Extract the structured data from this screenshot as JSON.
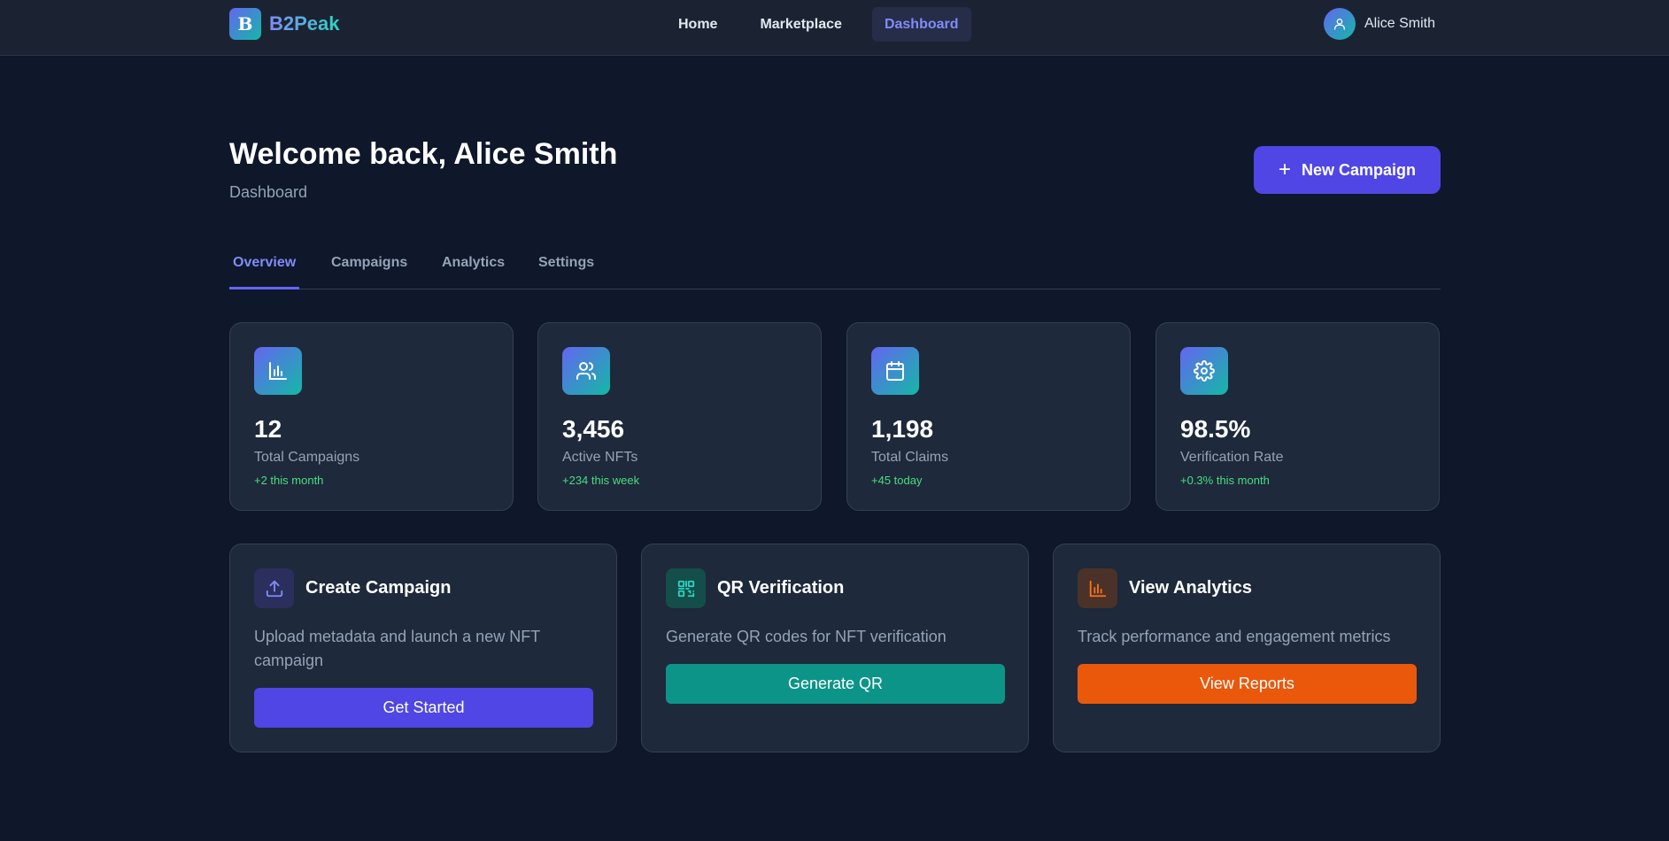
{
  "brand": {
    "logo_letter": "B",
    "name": "B2Peak"
  },
  "nav": {
    "items": [
      {
        "label": "Home"
      },
      {
        "label": "Marketplace"
      },
      {
        "label": "Dashboard",
        "active": true
      }
    ]
  },
  "user": {
    "name": "Alice Smith"
  },
  "header": {
    "welcome": "Welcome back, Alice Smith",
    "subtitle": "Dashboard",
    "new_campaign_label": "New Campaign"
  },
  "tabs": [
    {
      "label": "Overview",
      "active": true
    },
    {
      "label": "Campaigns"
    },
    {
      "label": "Analytics"
    },
    {
      "label": "Settings"
    }
  ],
  "stats": [
    {
      "icon": "bar-chart-icon",
      "value": "12",
      "label": "Total Campaigns",
      "delta": "+2 this month"
    },
    {
      "icon": "users-icon",
      "value": "3,456",
      "label": "Active NFTs",
      "delta": "+234 this week"
    },
    {
      "icon": "calendar-icon",
      "value": "1,198",
      "label": "Total Claims",
      "delta": "+45 today"
    },
    {
      "icon": "gear-icon",
      "value": "98.5%",
      "label": "Verification Rate",
      "delta": "+0.3% this month"
    }
  ],
  "actions": [
    {
      "icon": "upload-icon",
      "title": "Create Campaign",
      "description": "Upload metadata and launch a new NFT campaign",
      "button": "Get Started",
      "color": "#4f46e5"
    },
    {
      "icon": "qr-code-icon",
      "title": "QR Verification",
      "description": "Generate QR codes for NFT verification",
      "button": "Generate QR",
      "color": "#0d9488"
    },
    {
      "icon": "bar-chart-icon",
      "title": "View Analytics",
      "description": "Track performance and engagement metrics",
      "button": "View Reports",
      "color": "#ea580c"
    }
  ],
  "colors": {
    "accent": "#6366f1",
    "teal": "#14b8a6",
    "positive": "#4ade80",
    "background": "#0f172a"
  }
}
